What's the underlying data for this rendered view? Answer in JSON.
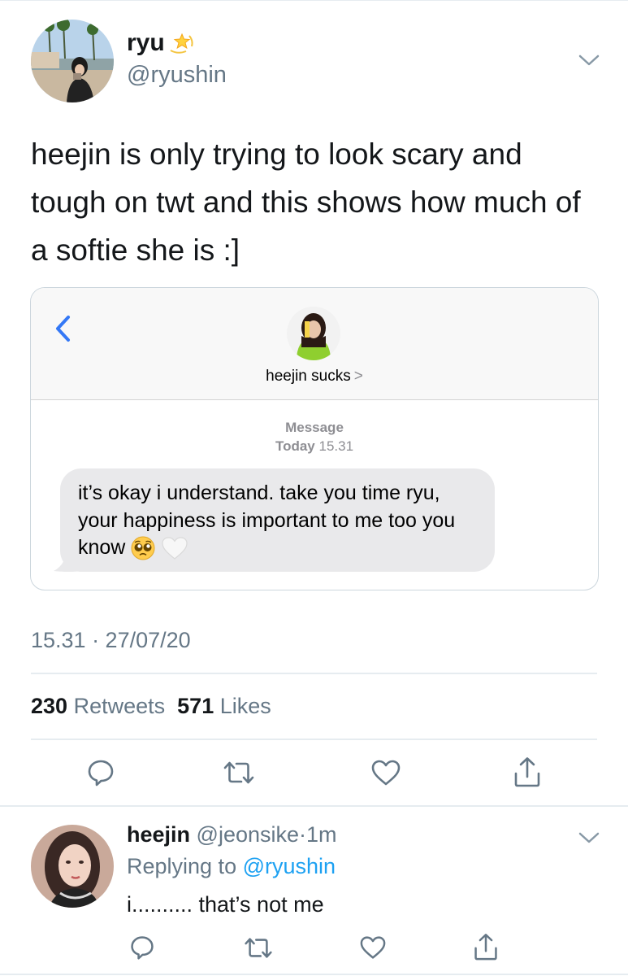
{
  "tweet": {
    "author_name": "ryu",
    "author_badge_icon": "dizzy-star-icon",
    "author_handle": "@ryushin",
    "text": "heejin is only trying to look scary and tough on twt and this shows how much of a softie she is :]",
    "timestamp": "15.31 · 27/07/20",
    "retweet_count": "230",
    "retweet_label": "Retweets",
    "like_count": "571",
    "like_label": "Likes"
  },
  "embed": {
    "contact_name": "heejin sucks",
    "contact_arrow": ">",
    "message_label": "Message",
    "time_day": "Today",
    "time_clock": "15.31",
    "message_text": "it’s okay i understand. take you time ryu, your happiness is important to me too you know",
    "emoji_icons": [
      "pleading-face-icon",
      "white-heart-icon"
    ]
  },
  "reply": {
    "author_name": "heejin",
    "author_handle": "@jeonsike",
    "separator": "·",
    "time": "1m",
    "replying_label": "Replying to",
    "replying_handle": "@ryushin",
    "text": "i.......... that’s not me"
  },
  "actions": [
    "reply-icon",
    "retweet-icon",
    "like-icon",
    "share-icon"
  ],
  "colors": {
    "link_blue": "#1da1f2",
    "secondary_text": "#657786",
    "ios_blue": "#3478f6",
    "bubble_gray": "#e9e9eb"
  }
}
